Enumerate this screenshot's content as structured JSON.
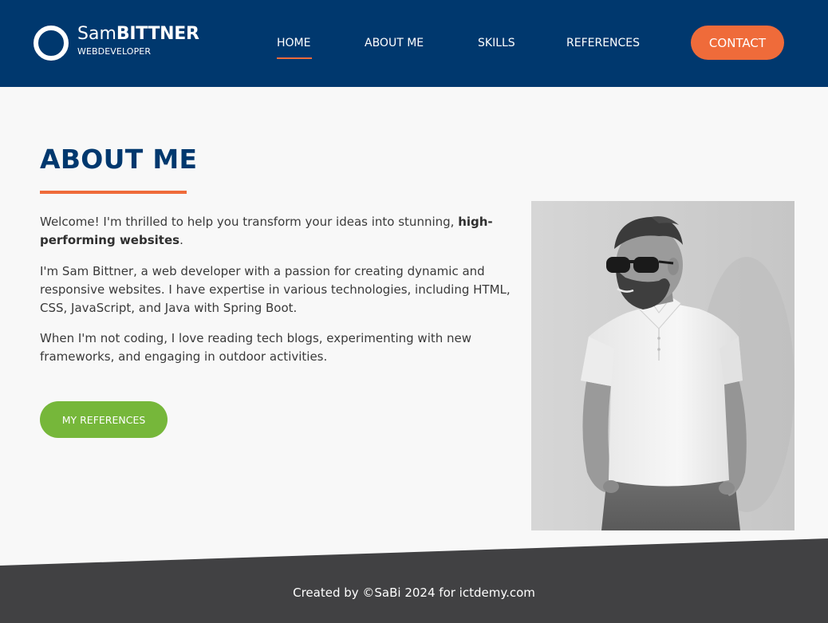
{
  "logo": {
    "first": "Sam",
    "last": "BITTNER",
    "subtitle": "WEBDEVELOPER"
  },
  "nav": {
    "home": "HOME",
    "about": "ABOUT ME",
    "skills": "SKILLS",
    "references": "REFERENCES",
    "contact": "CONTACT"
  },
  "about": {
    "title": "ABOUT ME",
    "p1_text": "Welcome! I'm thrilled to help you transform your ideas into stunning, ",
    "p1_bold": "high-performing websites",
    "p1_end": ".",
    "p2": "I'm Sam Bittner, a web developer with a passion for creating dynamic and responsive websites. I have expertise in various technologies, including HTML, CSS, JavaScript, and Java with Spring Boot.",
    "p3": "When I'm not coding, I love reading tech blogs, experimenting with new frameworks, and engaging in outdoor activities.",
    "button": "MY REFERENCES"
  },
  "footer": {
    "text": "Created by ©SaBi 2024 for ictdemy.com"
  },
  "colors": {
    "header_bg": "#00386e",
    "accent_orange": "#ef6b3a",
    "accent_green": "#76b73a",
    "footer_bg": "#414143",
    "page_bg": "#f8f8f8"
  }
}
